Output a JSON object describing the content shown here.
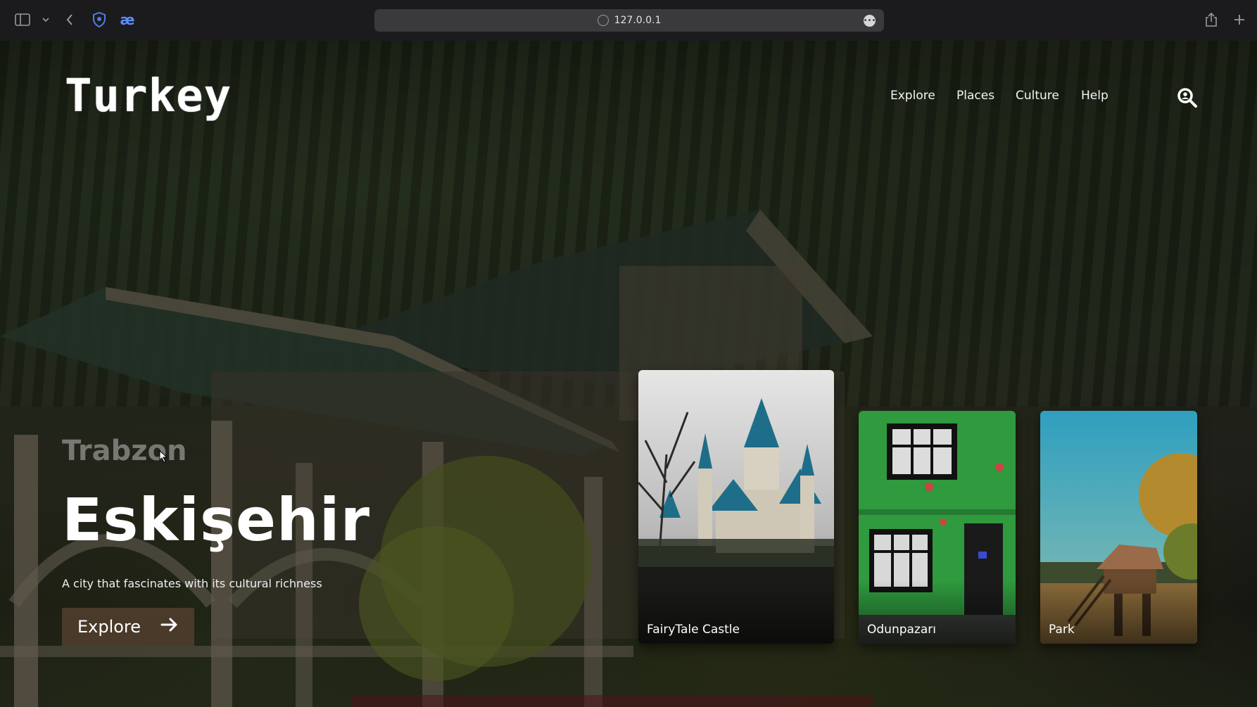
{
  "browser": {
    "url": "127.0.0.1",
    "more_icon": "ellipsis-icon"
  },
  "logo": "Turkey",
  "nav": {
    "items": [
      "Explore",
      "Places",
      "Culture",
      "Help"
    ]
  },
  "hero": {
    "previous_title": "Trabzon",
    "title": "Eskişehir",
    "subtitle": "A city that fascinates with its cultural richness",
    "button_label": "Explore"
  },
  "cards": [
    {
      "label": "FairyTale Castle"
    },
    {
      "label": "Odunpazarı"
    },
    {
      "label": "Park"
    }
  ],
  "colors": {
    "button_bg": "#4a3a2a",
    "text": "#ffffff"
  }
}
